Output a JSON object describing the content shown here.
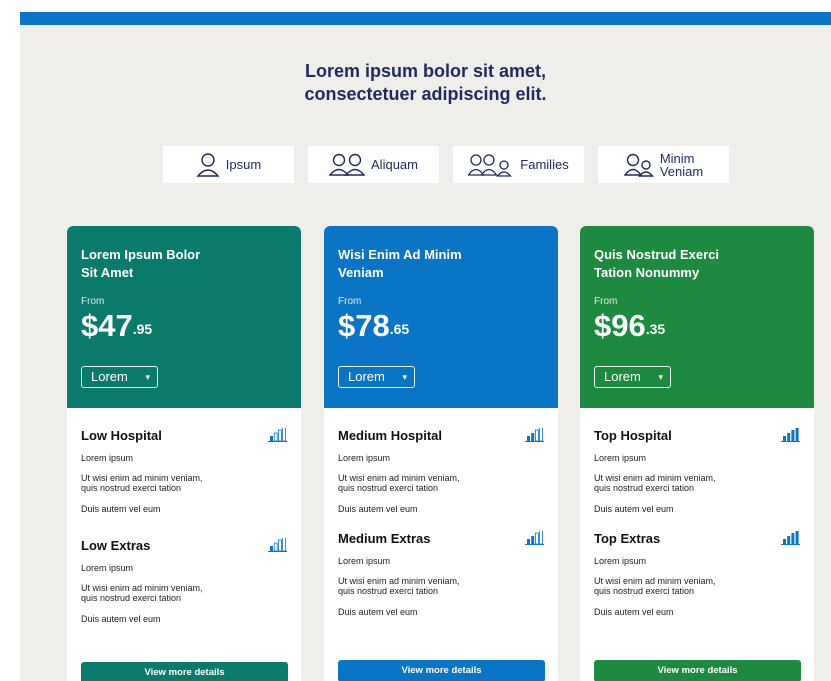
{
  "heading": {
    "line1": "Lorem ipsum bolor sit amet,",
    "line2": "consectetuer adipiscing elit."
  },
  "segments": [
    {
      "label": "Ipsum",
      "icon": "single-person-icon"
    },
    {
      "label": "Aliquam",
      "icon": "couple-icon"
    },
    {
      "label": "Families",
      "icon": "family-icon"
    },
    {
      "label_line1": "Minim",
      "label_line2": "Veniam",
      "icon": "parent-child-icon"
    }
  ],
  "plans": [
    {
      "title_line1": "Lorem Ipsum Bolor",
      "title_line2": "Sit Amet",
      "from": "From",
      "price_dollars": "$47",
      "price_cents": ".95",
      "select_value": "Lorem",
      "color": "#0a7a6c",
      "hospital": {
        "title": "Low Hospital",
        "level": 0.25,
        "l1": "Lorem ipsum",
        "l2a": "Ut wisi enim ad minim veniam,",
        "l2b": "quis nostrud exerci tation",
        "l3": "Duis autem vel eum"
      },
      "extras": {
        "title": "Low Extras",
        "level": 0.25,
        "l1": "Lorem ipsum",
        "l2a": "Ut wisi enim ad minim veniam,",
        "l2b": "quis nostrud exerci tation",
        "l3": "Duis autem vel eum"
      },
      "cta": "View more details"
    },
    {
      "title_line1": "Wisi Enim Ad Minim",
      "title_line2": "Veniam",
      "from": "From",
      "price_dollars": "$78",
      "price_cents": ".65",
      "select_value": "Lorem",
      "color": "#0a74c5",
      "hospital": {
        "title": "Medium Hospital",
        "level": 0.5,
        "l1": "Lorem ipsum",
        "l2a": "Ut wisi enim ad minim veniam,",
        "l2b": "quis nostrud exerci tation",
        "l3": "Duis autem vel eum"
      },
      "extras": {
        "title": "Medium Extras",
        "level": 0.5,
        "l1": "Lorem ipsum",
        "l2a": "Ut wisi enim ad minim veniam,",
        "l2b": "quis nostrud exerci tation",
        "l3": "Duis autem vel eum"
      },
      "cta": "View more details"
    },
    {
      "title_line1": "Quis Nostrud Exerci",
      "title_line2": "Tation Nonummy",
      "from": "From",
      "price_dollars": "$96",
      "price_cents": ".35",
      "select_value": "Lorem",
      "color": "#1e8a3f",
      "hospital": {
        "title": "Top Hospital",
        "level": 1.0,
        "l1": "Lorem ipsum",
        "l2a": "Ut wisi enim ad minim veniam,",
        "l2b": "quis nostrud exerci tation",
        "l3": "Duis autem vel eum"
      },
      "extras": {
        "title": "Top Extras",
        "level": 1.0,
        "l1": "Lorem ipsum",
        "l2a": "Ut wisi enim ad minim veniam,",
        "l2b": "quis nostrud exerci tation",
        "l3": "Duis autem vel eum"
      },
      "cta": "View more details"
    }
  ],
  "colors": {
    "bar_icon": "#0a74c5",
    "heading": "#1d2b5e",
    "background": "#efeeeb"
  }
}
